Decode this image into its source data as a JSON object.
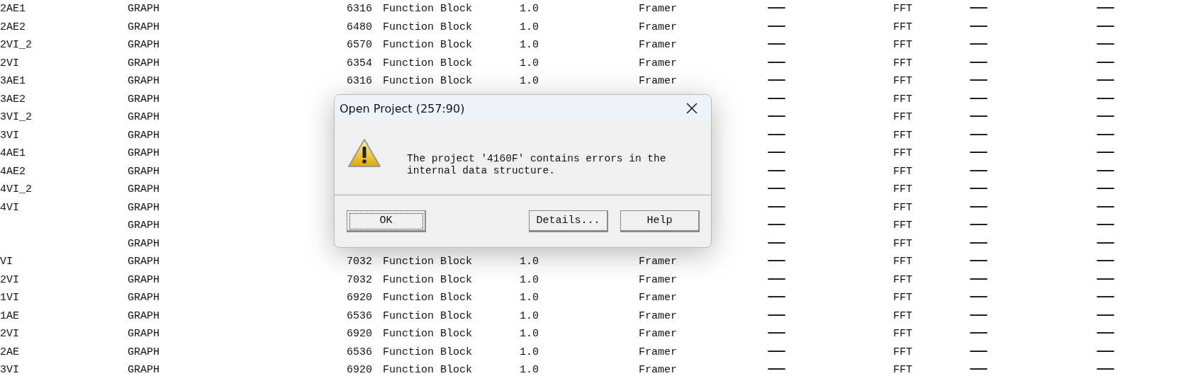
{
  "table": {
    "rows": [
      {
        "column_1": "2AE1",
        "column_2": "GRAPH",
        "column_3": "6316",
        "column_4": "Function Block",
        "column_5": "1.0",
        "column_6": "Framer",
        "column_7": "—",
        "column_8": "FFT",
        "column_9": "—",
        "column_10": "—"
      },
      {
        "column_1": "2AE2",
        "column_2": "GRAPH",
        "column_3": "6480",
        "column_4": "Function Block",
        "column_5": "1.0",
        "column_6": "Framer",
        "column_7": "—",
        "column_8": "FFT",
        "column_9": "—",
        "column_10": "—"
      },
      {
        "column_1": "2VI_2",
        "column_2": "GRAPH",
        "column_3": "6570",
        "column_4": "Function Block",
        "column_5": "1.0",
        "column_6": "Framer",
        "column_7": "—",
        "column_8": "FFT",
        "column_9": "—",
        "column_10": "—"
      },
      {
        "column_1": "2VI",
        "column_2": "GRAPH",
        "column_3": "6354",
        "column_4": "Function Block",
        "column_5": "1.0",
        "column_6": "Framer",
        "column_7": "—",
        "column_8": "FFT",
        "column_9": "—",
        "column_10": "—"
      },
      {
        "column_1": "3AE1",
        "column_2": "GRAPH",
        "column_3": "6316",
        "column_4": "Function Block",
        "column_5": "1.0",
        "column_6": "Framer",
        "column_7": "—",
        "column_8": "FFT",
        "column_9": "—",
        "column_10": "—"
      },
      {
        "column_1": "3AE2",
        "column_2": "GRAPH",
        "column_7": "—",
        "column_8": "FFT",
        "column_9": "—",
        "column_10": "—"
      },
      {
        "column_1": "3VI_2",
        "column_2": "GRAPH",
        "column_7": "—",
        "column_8": "FFT",
        "column_9": "—",
        "column_10": "—"
      },
      {
        "column_1": "3VI",
        "column_2": "GRAPH",
        "column_7": "—",
        "column_8": "FFT",
        "column_9": "—",
        "column_10": "—"
      },
      {
        "column_1": "4AE1",
        "column_2": "GRAPH",
        "column_7": "—",
        "column_8": "FFT",
        "column_9": "—",
        "column_10": "—"
      },
      {
        "column_1": "4AE2",
        "column_2": "GRAPH",
        "column_7": "—",
        "column_8": "FFT",
        "column_9": "—",
        "column_10": "—"
      },
      {
        "column_1": "4VI_2",
        "column_2": "GRAPH",
        "column_7": "—",
        "column_8": "FFT",
        "column_9": "—",
        "column_10": "—"
      },
      {
        "column_1": "4VI",
        "column_2": "GRAPH",
        "column_7": "—",
        "column_8": "FFT",
        "column_9": "—",
        "column_10": "—"
      },
      {
        "column_2": "GRAPH",
        "column_7": "—",
        "column_8": "FFT",
        "column_9": "—",
        "column_10": "—"
      },
      {
        "column_2": "GRAPH",
        "column_7": "—",
        "column_8": "FFT",
        "column_9": "—",
        "column_10": "—"
      },
      {
        "column_1": "VI",
        "column_2": "GRAPH",
        "column_3": "7032",
        "column_4": "Function Block",
        "column_5": "1.0",
        "column_6": "Framer",
        "column_7": "—",
        "column_8": "FFT",
        "column_9": "—",
        "column_10": "—"
      },
      {
        "column_1": "2VI",
        "column_2": "GRAPH",
        "column_3": "7032",
        "column_4": "Function Block",
        "column_5": "1.0",
        "column_6": "Framer",
        "column_7": "—",
        "column_8": "FFT",
        "column_9": "—",
        "column_10": "—"
      },
      {
        "column_1": "1VI",
        "column_2": "GRAPH",
        "column_3": "6920",
        "column_4": "Function Block",
        "column_5": "1.0",
        "column_6": "Framer",
        "column_7": "—",
        "column_8": "FFT",
        "column_9": "—",
        "column_10": "—"
      },
      {
        "column_1": "1AE",
        "column_2": "GRAPH",
        "column_3": "6536",
        "column_4": "Function Block",
        "column_5": "1.0",
        "column_6": "Framer",
        "column_7": "—",
        "column_8": "FFT",
        "column_9": "—",
        "column_10": "—"
      },
      {
        "column_1": "2VI",
        "column_2": "GRAPH",
        "column_3": "6920",
        "column_4": "Function Block",
        "column_5": "1.0",
        "column_6": "Framer",
        "column_7": "—",
        "column_8": "FFT",
        "column_9": "—",
        "column_10": "—"
      },
      {
        "column_1": "2AE",
        "column_2": "GRAPH",
        "column_3": "6536",
        "column_4": "Function Block",
        "column_5": "1.0",
        "column_6": "Framer",
        "column_7": "—",
        "column_8": "FFT",
        "column_9": "—",
        "column_10": "—"
      },
      {
        "column_1": "3VI",
        "column_2": "GRAPH",
        "column_3": "6920",
        "column_4": "Function Block",
        "column_5": "1.0",
        "column_6": "Framer",
        "column_7": "—",
        "column_8": "FFT",
        "column_9": "—",
        "column_10": "—"
      }
    ]
  },
  "dialog": {
    "title": "Open Project (257:90)",
    "message": "The project '4160F' contains errors in the internal data structure.",
    "buttons": [
      {
        "label": "OK",
        "focused": true
      },
      {
        "label": "Details...",
        "focused": false
      },
      {
        "label": "Help",
        "focused": false
      }
    ]
  }
}
